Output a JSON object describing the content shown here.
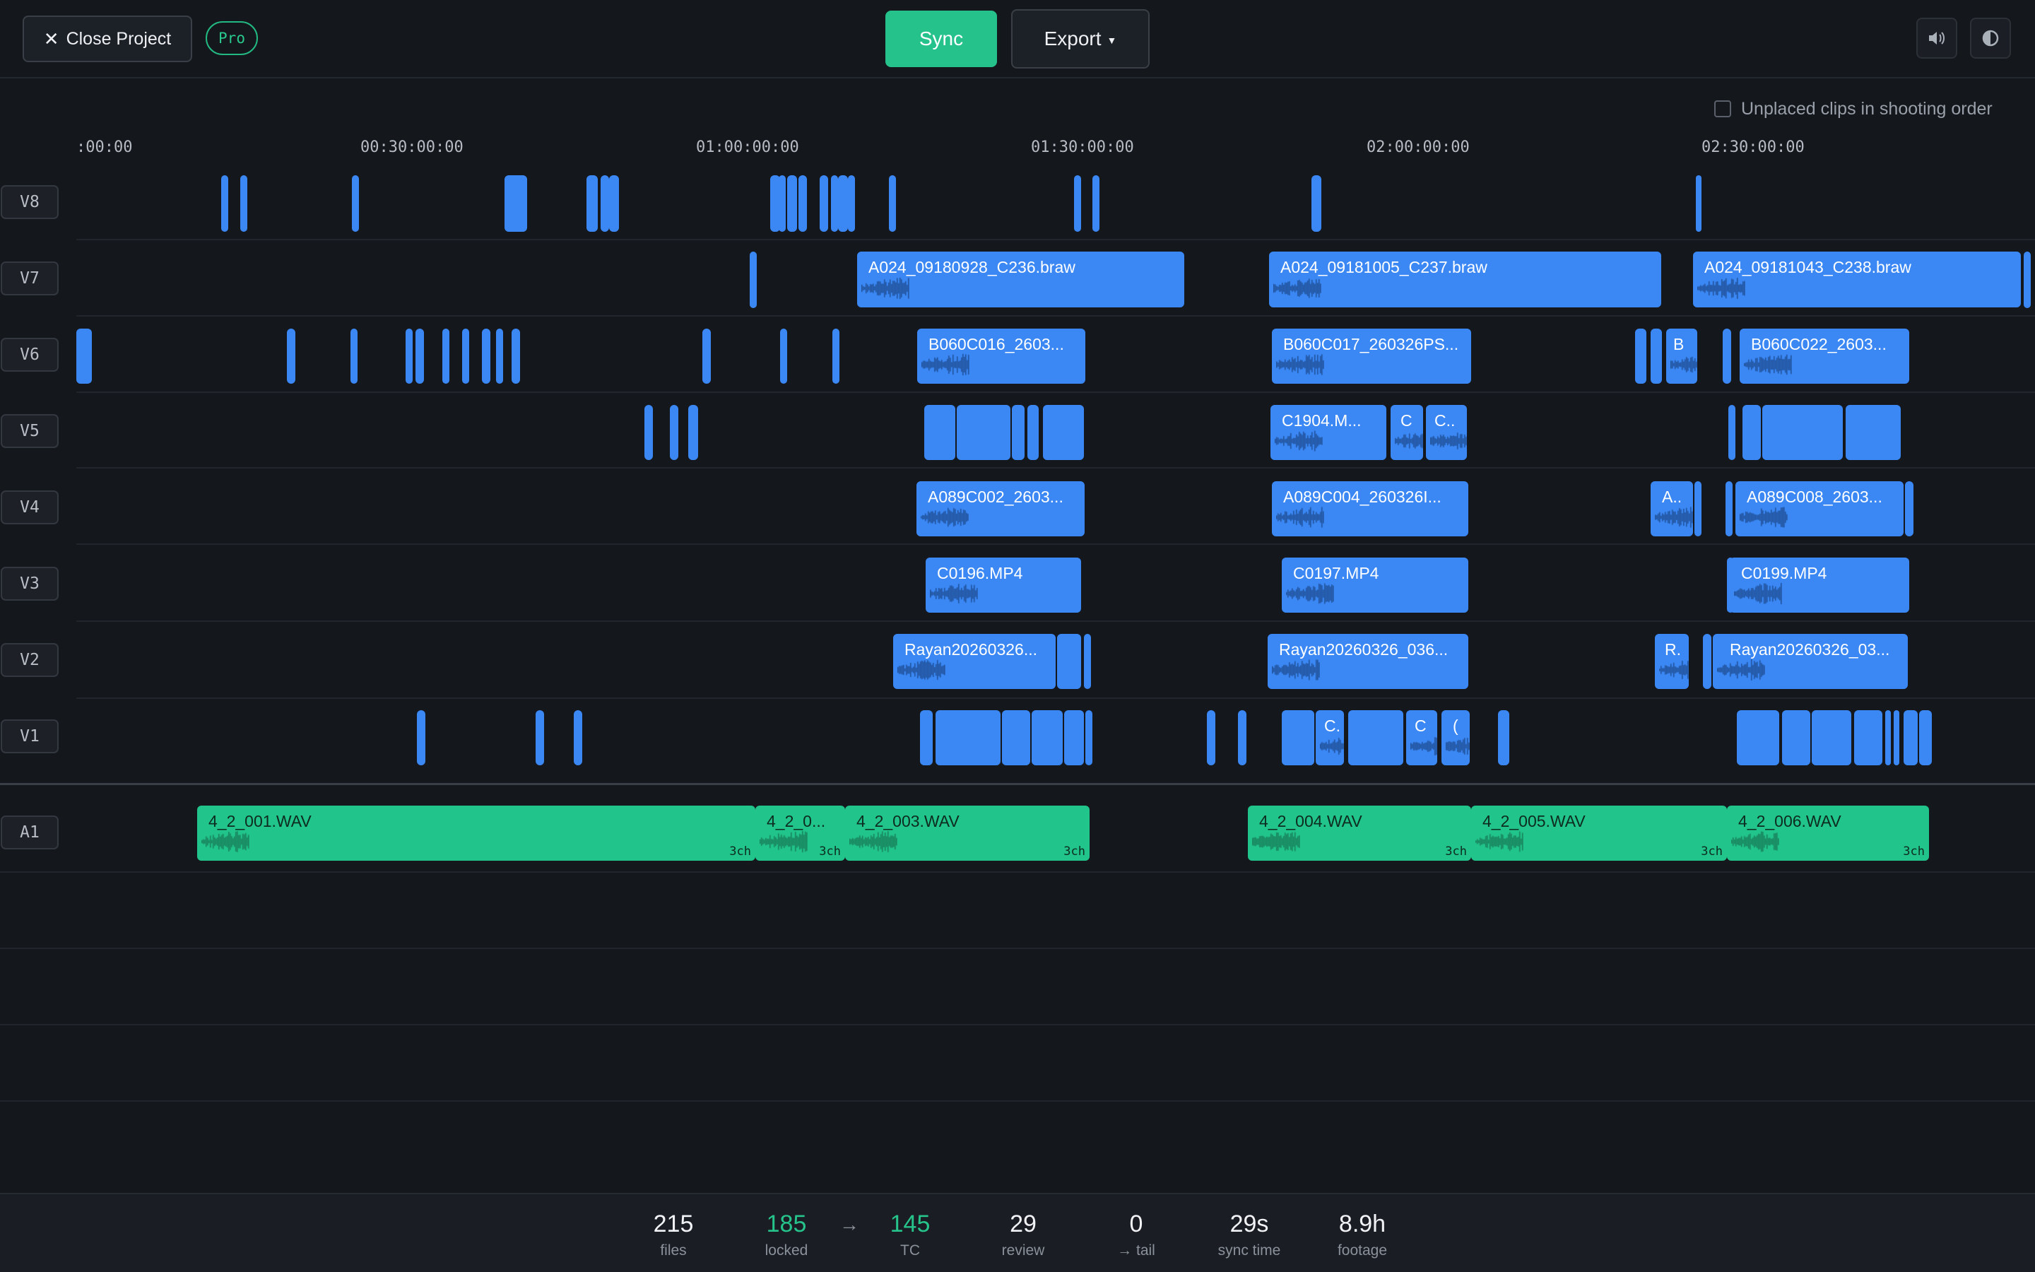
{
  "header": {
    "close_label": "Close Project",
    "badge": "Pro",
    "sync_label": "Sync",
    "export_label": "Export",
    "volume_icon": "speaker-icon",
    "theme_icon": "contrast-icon"
  },
  "unplaced_label": "Unplaced clips in shooting order",
  "ruler": [
    ":00:00",
    "00:30:00:00",
    "01:00:00:00",
    "01:30:00:00",
    "02:00:00:00",
    "02:30:00:00"
  ],
  "tracks": [
    "V8",
    "V7",
    "V6",
    "V5",
    "V4",
    "V3",
    "V2",
    "V1",
    "A1"
  ],
  "clips": {
    "v7_a": "A024_09180928_C236.braw",
    "v7_b": "A024_09181005_C237.braw",
    "v7_c": "A024_09181043_C238.braw",
    "v6_a": "B060C016_2603...",
    "v6_b": "B060C017_260326PS...",
    "v6_c": "B",
    "v6_d": "B060C022_2603...",
    "v5_a": "C1904.M...",
    "v5_b": "C",
    "v5_c": "C..",
    "v4_a": "A089C002_2603...",
    "v4_b": "A089C004_260326I...",
    "v4_c": "A..",
    "v4_d": "A089C008_2603...",
    "v3_a": "C0196.MP4",
    "v3_b": "C0197.MP4",
    "v3_c": "C0199.MP4",
    "v2_a": "Rayan20260326...",
    "v2_b": "Rayan20260326_036...",
    "v2_c": "R.",
    "v2_d": "Rayan20260326_03...",
    "v1_a": "C.",
    "v1_b": "C",
    "v1_c": "(",
    "a1_a": "4_2_001.WAV",
    "a1_b": "4_2_0...",
    "a1_c": "4_2_003.WAV",
    "a1_d": "4_2_004.WAV",
    "a1_e": "4_2_005.WAV",
    "a1_f": "4_2_006.WAV",
    "channels": "3ch"
  },
  "stats": [
    {
      "value": "215",
      "label": "files"
    },
    {
      "value": "185",
      "label": "locked"
    },
    {
      "value": "145",
      "label": "TC"
    },
    {
      "value": "29",
      "label": "review"
    },
    {
      "value": "0",
      "label": "→ tail"
    },
    {
      "value": "29s",
      "label": "sync time"
    },
    {
      "value": "8.9h",
      "label": "footage"
    }
  ],
  "colors": {
    "video_clip": "#3b88f5",
    "audio_clip": "#21c48a",
    "accent": "#25c28b"
  }
}
